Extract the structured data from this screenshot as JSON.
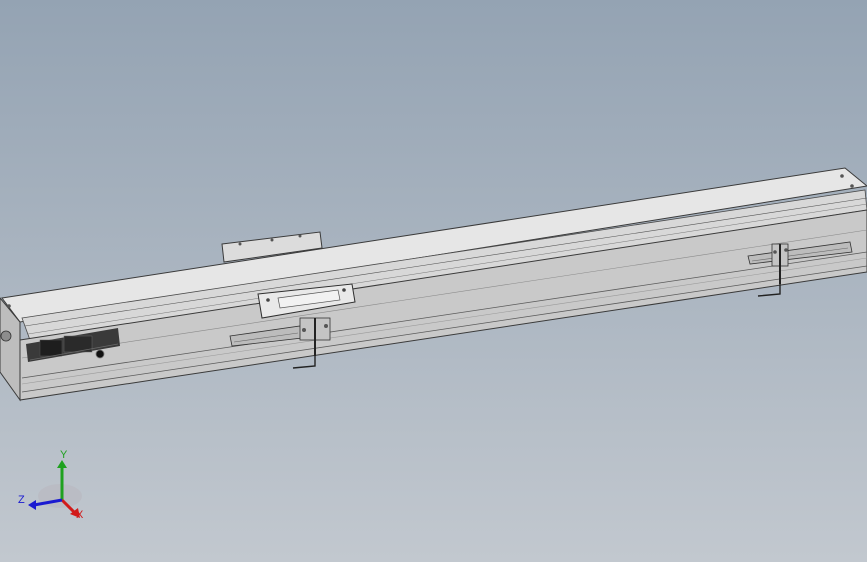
{
  "viewport": {
    "background_top": "#94a3b3",
    "background_bottom": "#c2c8cf"
  },
  "model": {
    "body_color": "#d3d3d3",
    "edge_color": "#3a3a3a"
  },
  "triad": {
    "x_label": "X",
    "y_label": "Y",
    "z_label": "Z",
    "x_color": "#d11a1a",
    "y_color": "#1fa11f",
    "z_color": "#1a1ad1"
  }
}
